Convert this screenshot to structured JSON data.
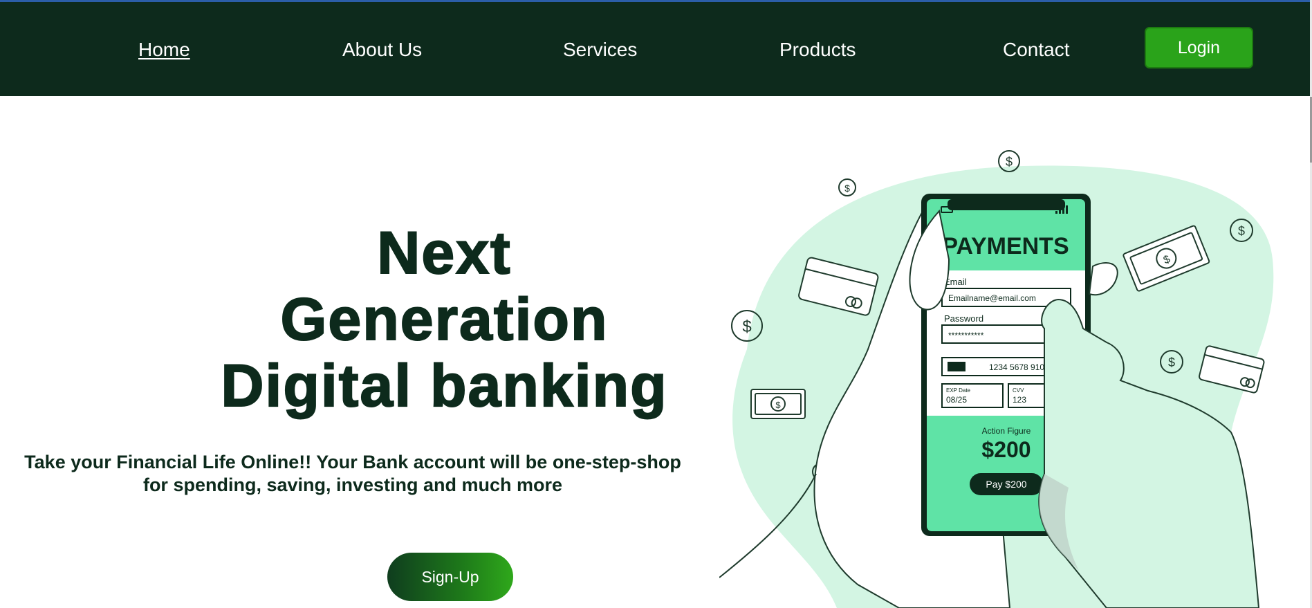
{
  "nav": {
    "links": [
      "Home",
      "About Us",
      "Services",
      "Products",
      "Contact"
    ],
    "login_label": "Login"
  },
  "hero": {
    "title_lines": [
      "Next",
      "Generation",
      "Digital banking"
    ],
    "subtitle_line1": "Take your Financial Life Online!! Your Bank account will be one-step-shop",
    "subtitle_line2": "for spending, saving, investing and much more",
    "signup_label": "Sign-Up"
  },
  "illustration": {
    "screen_title": "PAYMENTS",
    "email_label": "Email",
    "email_value": "Emailname@email.com",
    "password_label": "Password",
    "password_value": "***********",
    "card_number": "1234 5678 910",
    "exp_label": "EXP Date",
    "exp_value": "08/25",
    "cvv_label": "CVV",
    "cvv_value": "123",
    "action_label": "Action Figure",
    "amount": "$200",
    "pay_label": "Pay $200",
    "dollar_symbol": "$"
  },
  "colors": {
    "nav_bg": "#0d2a1c",
    "accent_green": "#2aa31a",
    "mint": "#d3f5e3",
    "phone_green": "#5fe3a6"
  }
}
